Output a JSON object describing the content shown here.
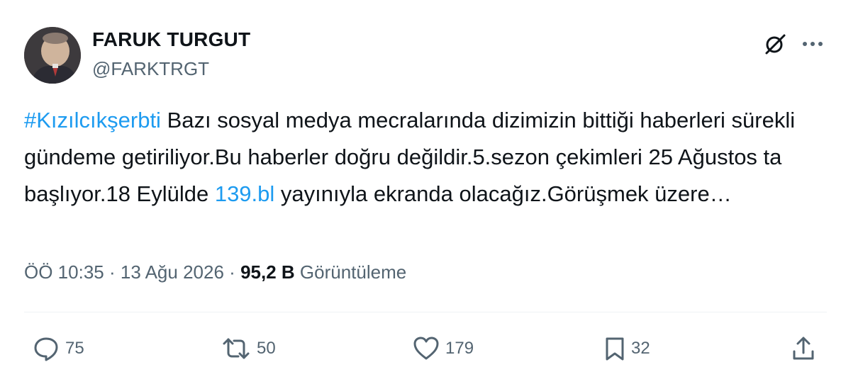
{
  "author": {
    "name": "FARUK TURGUT",
    "handle": "@FARKTRGT"
  },
  "tweet": {
    "hashtag": "#Kızılcıkşerbti",
    "text_part1": " Bazı sosyal medya mecralarında dizimizin bittiği haberleri sürekli gündeme getiriliyor.Bu haberler doğru değildir.5.sezon çekimleri 25 Ağustos ta başlıyor.18 Eylülde ",
    "link": "139.bl",
    "text_part2": " yayınıyla ekranda olacağız.Görüşmek üzere…"
  },
  "meta": {
    "time": "ÖÖ 10:35",
    "date": "13 Ağu 2026",
    "separator": "·",
    "views_count": "95,2 B",
    "views_label": "Görüntüleme"
  },
  "actions": {
    "replies": "75",
    "reposts": "50",
    "likes": "179",
    "bookmarks": "32"
  },
  "colors": {
    "accent": "#1d9bf0",
    "secondary_text": "#536471",
    "primary_text": "#0f1419"
  }
}
